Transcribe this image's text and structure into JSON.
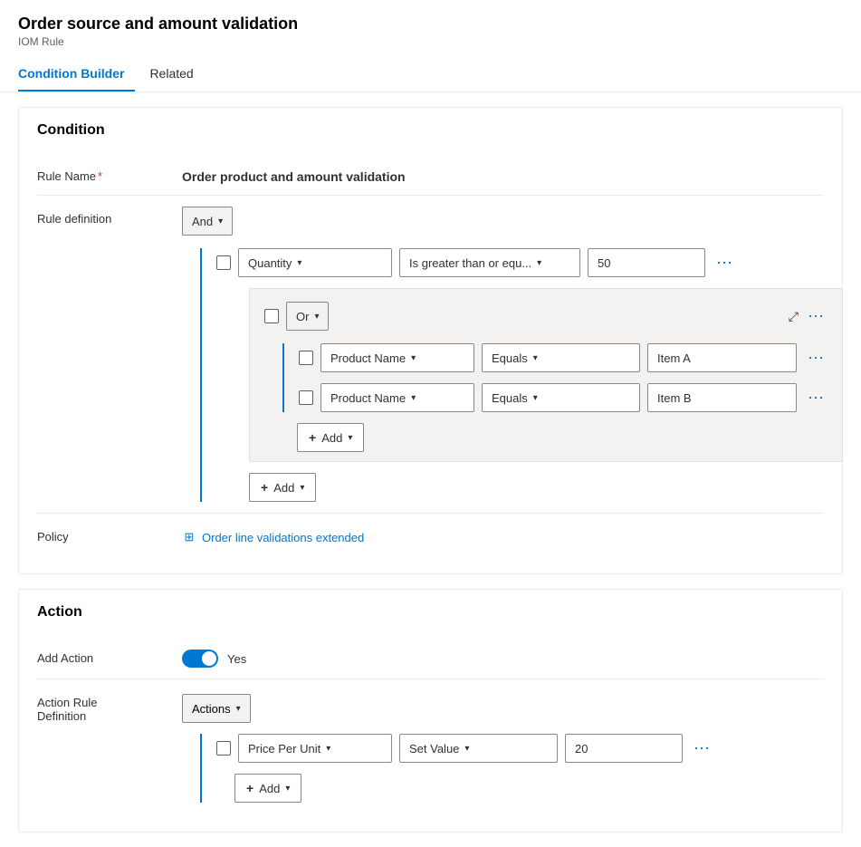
{
  "page": {
    "title": "Order source and amount validation",
    "subtitle": "IOM Rule"
  },
  "tabs": [
    {
      "id": "condition-builder",
      "label": "Condition Builder",
      "active": true
    },
    {
      "id": "related",
      "label": "Related",
      "active": false
    }
  ],
  "condition_section": {
    "heading": "Condition",
    "rule_name_label": "Rule Name",
    "rule_name_value": "Order product and amount validation",
    "rule_definition_label": "Rule definition",
    "and_label": "And",
    "quantity_row": {
      "field": "Quantity",
      "operator": "Is greater than or equ...",
      "value": "50"
    },
    "or_group": {
      "or_label": "Or",
      "rows": [
        {
          "field": "Product Name",
          "operator": "Equals",
          "value": "Item A"
        },
        {
          "field": "Product Name",
          "operator": "Equals",
          "value": "Item B"
        }
      ],
      "add_label": "Add"
    },
    "add_label": "Add",
    "policy_label": "Policy",
    "policy_link_text": "Order line validations extended"
  },
  "action_section": {
    "heading": "Action",
    "add_action_label": "Add Action",
    "toggle_value": "Yes",
    "action_rule_label": "Action Rule\nDefinition",
    "actions_dropdown": "Actions",
    "action_row": {
      "field": "Price Per Unit",
      "operator": "Set Value",
      "value": "20"
    },
    "add_label": "Add"
  },
  "icons": {
    "chevron": "▾",
    "plus": "+",
    "more": "⋯",
    "collapse": "⤢",
    "policy": "⊞"
  }
}
